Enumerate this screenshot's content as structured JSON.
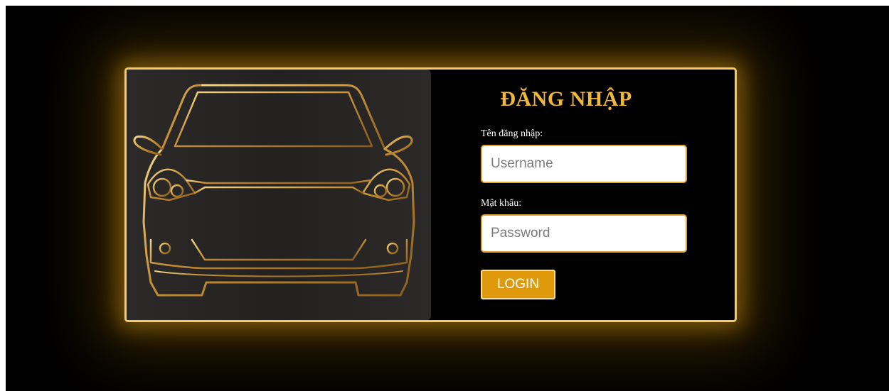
{
  "login": {
    "title": "ĐĂNG NHẬP",
    "username_label": "Tên đăng nhập:",
    "username_placeholder": "Username",
    "username_value": "",
    "password_label": "Mật khẩu:",
    "password_placeholder": "Password",
    "password_value": "",
    "submit_label": "LOGIN"
  },
  "illustration": {
    "icon": "car-front-outline-icon"
  },
  "colors": {
    "background": "#000000",
    "accent_gold": "#f0b83a",
    "border_gold": "#f6c96a",
    "button": "#df9a0c",
    "illustration_panel": "#2a2827"
  }
}
